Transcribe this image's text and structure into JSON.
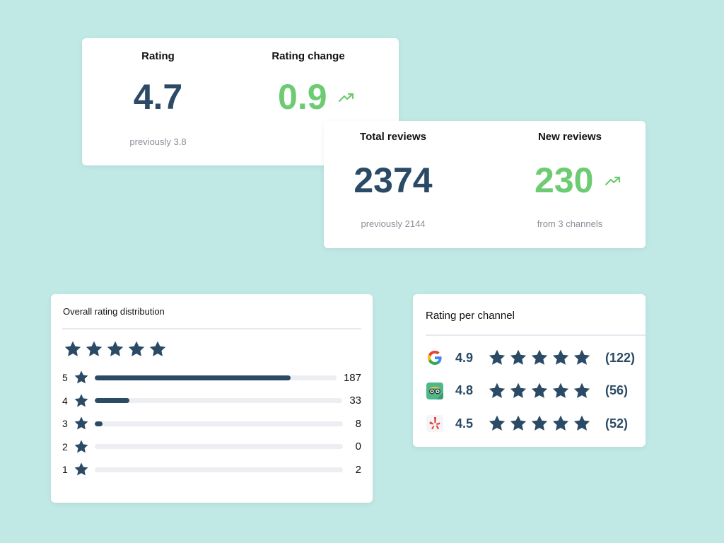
{
  "rating_card": {
    "rating": {
      "title": "Rating",
      "value": "4.7",
      "sub": "previously 3.8"
    },
    "change": {
      "title": "Rating change",
      "value": "0.9",
      "trend_icon": "trending-up-icon"
    }
  },
  "reviews_card": {
    "total": {
      "title": "Total reviews",
      "value": "2374",
      "sub": "previously 2144"
    },
    "new": {
      "title": "New reviews",
      "value": "230",
      "sub": "from 3 channels",
      "trend_icon": "trending-up-icon"
    }
  },
  "distribution": {
    "title": "Overall rating distribution",
    "overall_stars": 5,
    "rows": [
      {
        "stars": "5",
        "count": "187",
        "fraction": 0.81
      },
      {
        "stars": "4",
        "count": "33",
        "fraction": 0.14
      },
      {
        "stars": "3",
        "count": "8",
        "fraction": 0.03
      },
      {
        "stars": "2",
        "count": "0",
        "fraction": 0
      },
      {
        "stars": "1",
        "count": "2",
        "fraction": 0
      }
    ]
  },
  "channels": {
    "title": "Rating per channel",
    "rows": [
      {
        "name": "google",
        "icon": "google-logo-icon",
        "rating": "4.9",
        "stars": 5,
        "count": "(122)"
      },
      {
        "name": "tripadvisor",
        "icon": "tripadvisor-logo-icon",
        "rating": "4.8",
        "stars": 5,
        "count": "(56)"
      },
      {
        "name": "yelp",
        "icon": "yelp-logo-icon",
        "rating": "4.5",
        "stars": 5,
        "count": "(52)"
      }
    ]
  },
  "colors": {
    "background": "#c0e8e5",
    "navy": "#2b4a66",
    "green": "#6dcb72",
    "muted": "#8a8f99",
    "track": "#eceef2"
  }
}
